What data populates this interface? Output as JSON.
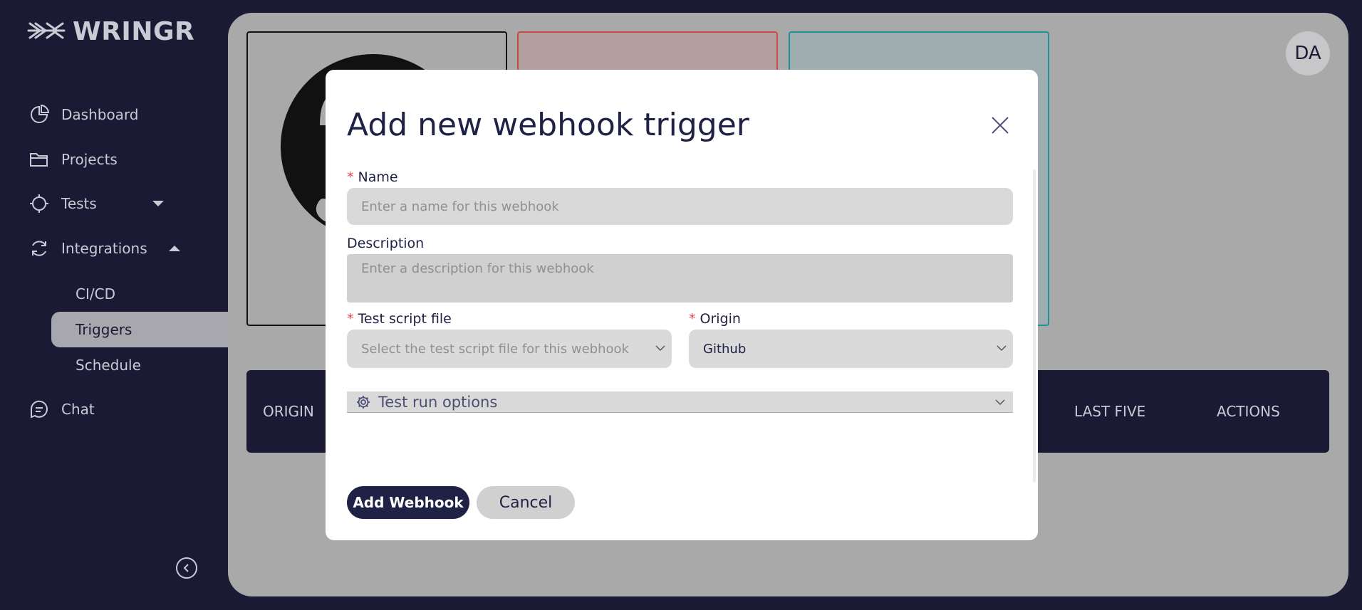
{
  "app": {
    "logo_text": "WRINGR"
  },
  "sidebar": {
    "items": [
      {
        "label": "Dashboard",
        "icon": "pie-chart-icon"
      },
      {
        "label": "Projects",
        "icon": "folder-icon"
      },
      {
        "label": "Tests",
        "icon": "crosshair-icon"
      },
      {
        "label": "Integrations",
        "icon": "refresh-icon"
      },
      {
        "label": "Chat",
        "icon": "chat-icon"
      }
    ],
    "sub_items": [
      {
        "label": "CI/CD"
      },
      {
        "label": "Triggers"
      },
      {
        "label": "Schedule"
      }
    ]
  },
  "header": {
    "avatar_initials": "DA"
  },
  "table": {
    "columns": [
      "ORIGIN",
      "LAST FIVE",
      "ACTIONS"
    ]
  },
  "modal": {
    "title": "Add new webhook trigger",
    "name_label": "Name",
    "name_placeholder": "Enter a name for this webhook",
    "description_label": "Description",
    "description_placeholder": "Enter a description for this webhook",
    "script_label": "Test script file",
    "script_placeholder": "Select the test script file for this webhook",
    "origin_label": "Origin",
    "origin_value": "Github",
    "options_label": "Test run options",
    "submit_label": "Add Webhook",
    "cancel_label": "Cancel"
  },
  "colors": {
    "sidebar_bg": "#1a1a35",
    "primary": "#1f2145",
    "required": "#e04848"
  }
}
